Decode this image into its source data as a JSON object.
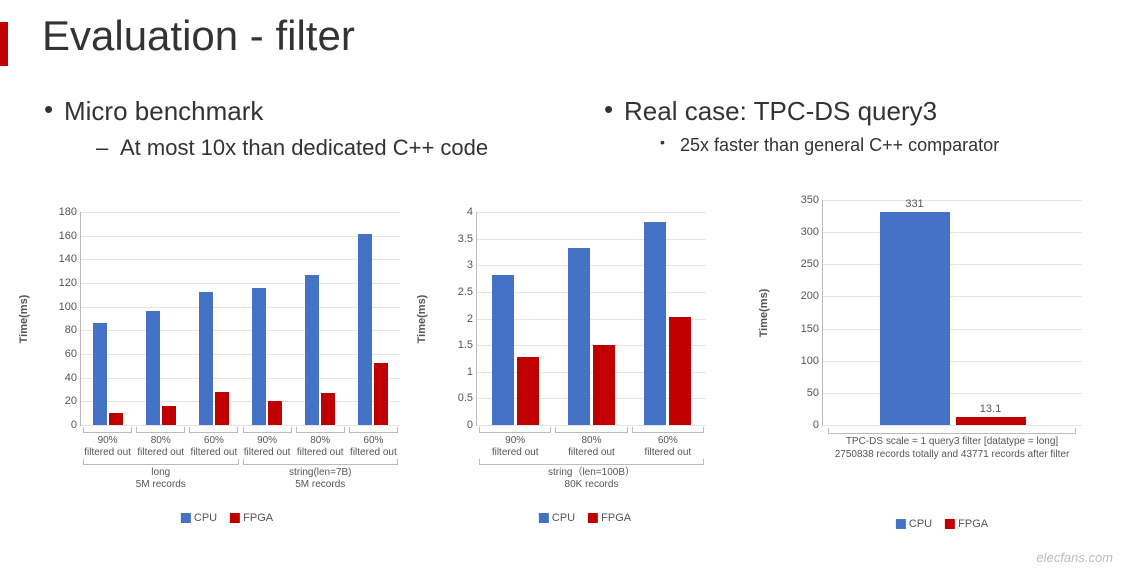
{
  "title": "Evaluation - filter",
  "left": {
    "heading": "Micro benchmark",
    "sub": "At most 10x than dedicated C++ code"
  },
  "right": {
    "heading": "Real case: TPC-DS query3",
    "sub": "25x faster than general C++ comparator"
  },
  "legend": {
    "cpu": "CPU",
    "fpga": "FPGA"
  },
  "ylabel": "Time(ms)",
  "watermark": "elecfans.com",
  "chart_data": [
    {
      "type": "bar",
      "ylabel": "Time(ms)",
      "ylim": [
        0,
        180
      ],
      "yticks": [
        0,
        20,
        40,
        60,
        80,
        100,
        120,
        140,
        160,
        180
      ],
      "categories": [
        "90% filtered out",
        "80% filtered out",
        "60% filtered out",
        "90% filtered out",
        "80% filtered out",
        "60% filtered out"
      ],
      "groups": [
        {
          "label": "long\n5M records",
          "span": [
            0,
            2
          ]
        },
        {
          "label": "string(len=7B)\n5M records",
          "span": [
            3,
            5
          ]
        }
      ],
      "series": [
        {
          "name": "CPU",
          "values": [
            86,
            96,
            112,
            116,
            127,
            161
          ]
        },
        {
          "name": "FPGA",
          "values": [
            10,
            16,
            28,
            20,
            27,
            52
          ]
        }
      ]
    },
    {
      "type": "bar",
      "ylabel": "Time(ms)",
      "ylim": [
        0,
        4
      ],
      "yticks": [
        0,
        0.5,
        1,
        1.5,
        2,
        2.5,
        3,
        3.5,
        4
      ],
      "categories": [
        "90% filtered out",
        "80% filtered out",
        "60% filtered out"
      ],
      "groups": [
        {
          "label": "string（len=100B）\n80K records",
          "span": [
            0,
            2
          ]
        }
      ],
      "series": [
        {
          "name": "CPU",
          "values": [
            2.82,
            3.32,
            3.82
          ]
        },
        {
          "name": "FPGA",
          "values": [
            1.28,
            1.5,
            2.02
          ]
        }
      ]
    },
    {
      "type": "bar",
      "ylabel": "Time(ms)",
      "ylim": [
        0,
        350
      ],
      "yticks": [
        0,
        50,
        100,
        150,
        200,
        250,
        300,
        350
      ],
      "categories": [
        "CPU",
        "FPGA"
      ],
      "data_labels": [
        "331",
        "13.1"
      ],
      "footer_lines": [
        "TPC-DS scale = 1 query3 filter [datatype = long]",
        "2750838 records totally and 43771 records after filter"
      ],
      "series": [
        {
          "name": "CPU",
          "values": [
            331
          ]
        },
        {
          "name": "FPGA",
          "values": [
            13.1
          ]
        }
      ]
    }
  ]
}
